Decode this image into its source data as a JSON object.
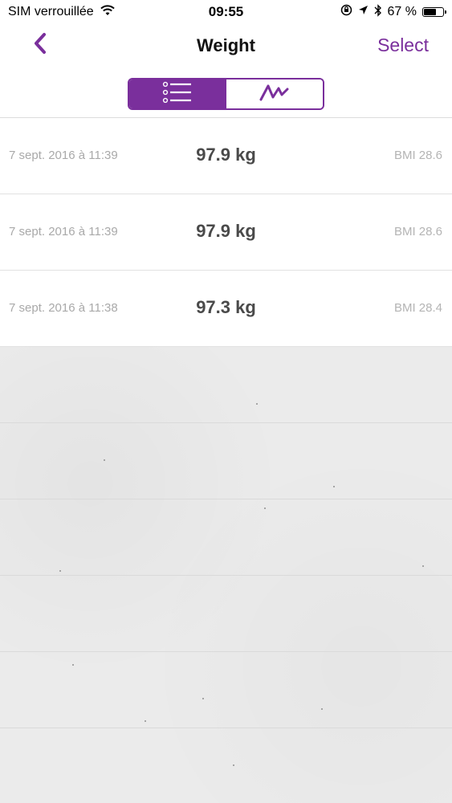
{
  "status_bar": {
    "carrier": "SIM verrouillée",
    "time": "09:55",
    "battery_percent": "67 %",
    "battery_level": 0.67
  },
  "nav": {
    "title": "Weight",
    "select_label": "Select"
  },
  "segmented_control": {
    "selected": "list",
    "segments": [
      "list",
      "graph"
    ]
  },
  "entries": [
    {
      "date": "7 sept. 2016 à 11:39",
      "weight": "97.9 kg",
      "bmi": "BMI 28.6"
    },
    {
      "date": "7 sept. 2016 à 11:39",
      "weight": "97.9 kg",
      "bmi": "BMI 28.6"
    },
    {
      "date": "7 sept. 2016 à 11:38",
      "weight": "97.3 kg",
      "bmi": "BMI 28.4"
    }
  ],
  "colors": {
    "accent": "#7a2f9c"
  },
  "icons": {
    "back": "chevron-left-icon",
    "list": "list-icon",
    "graph": "line-graph-icon"
  }
}
